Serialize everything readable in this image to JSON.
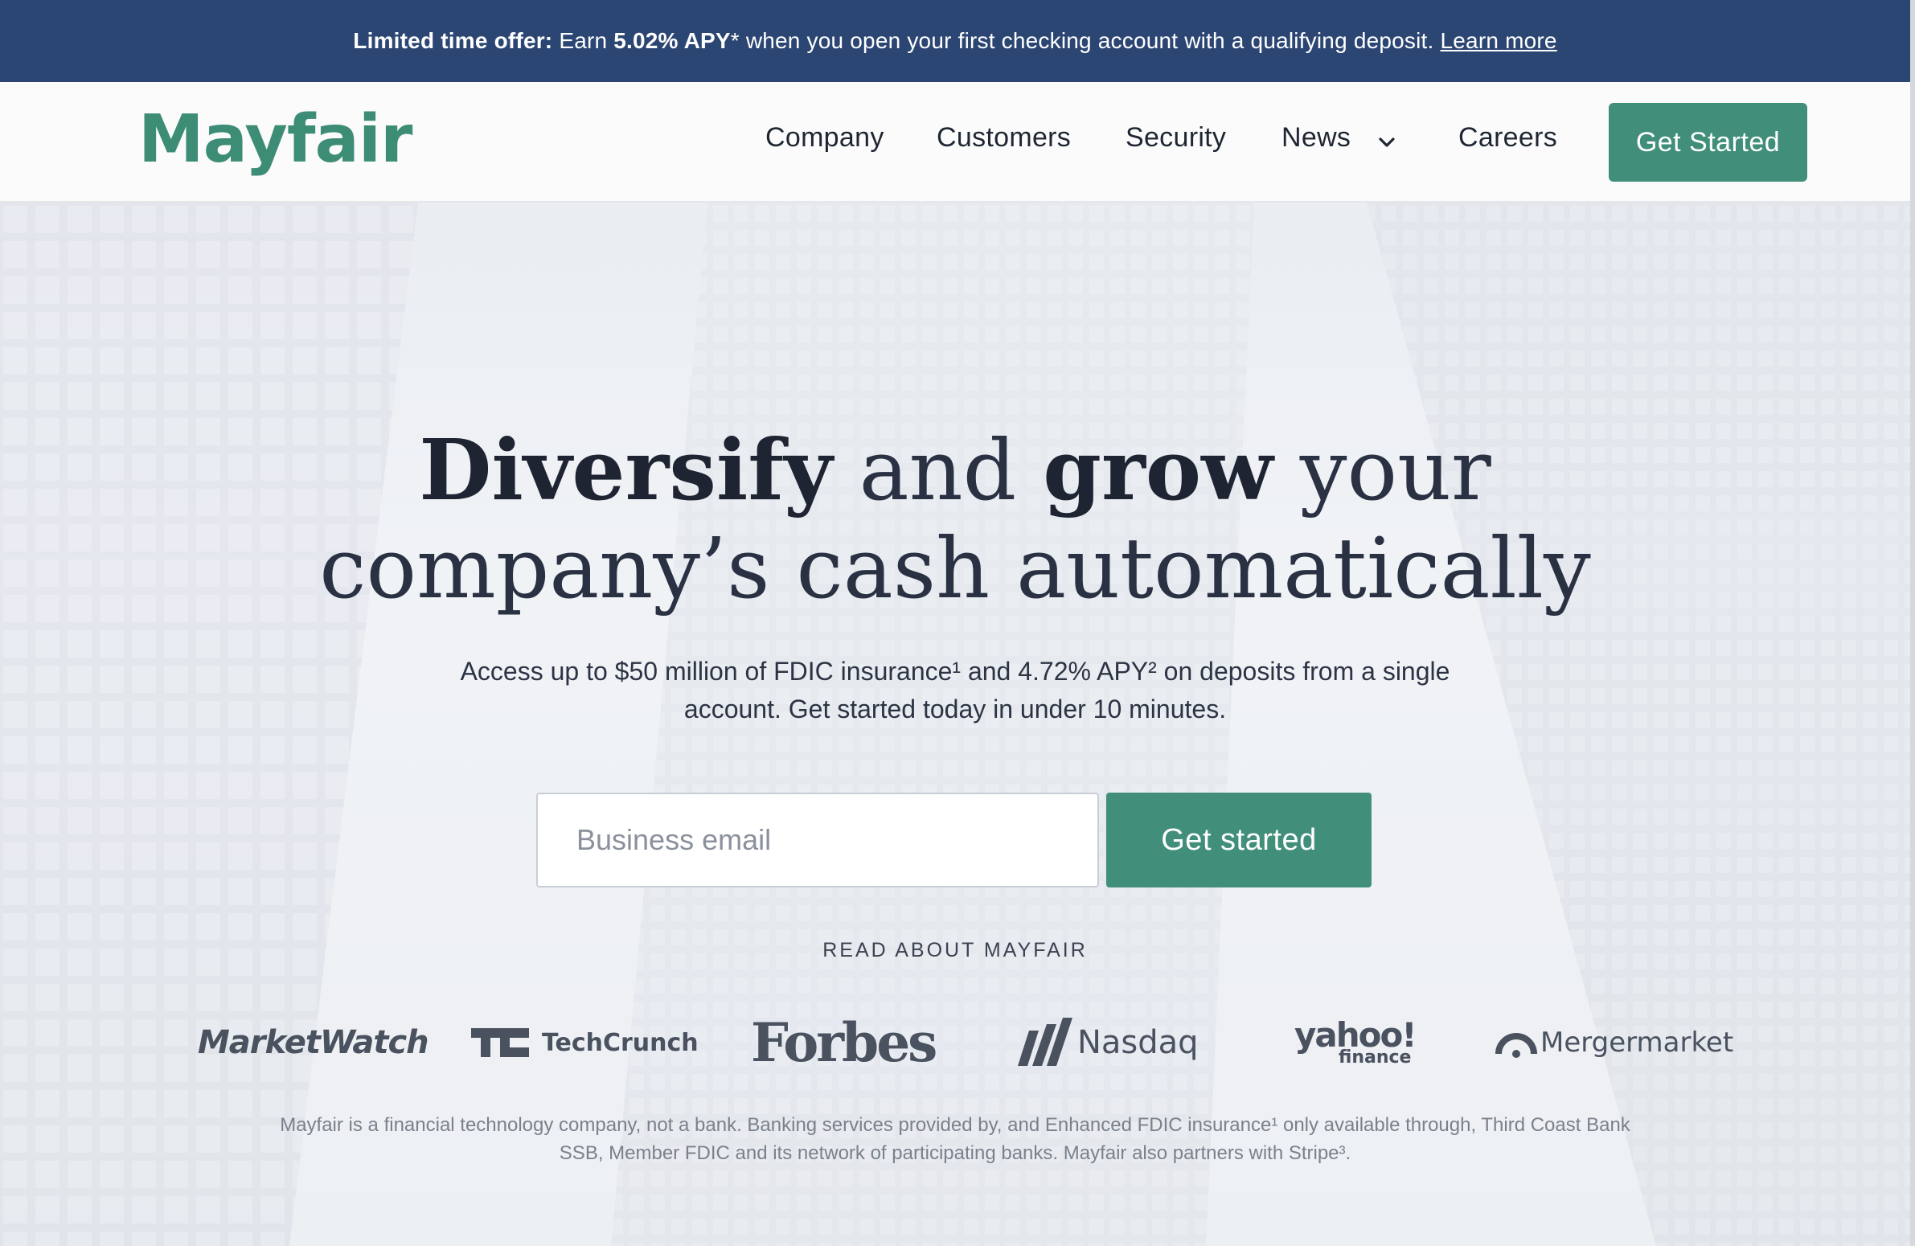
{
  "promo": {
    "lead": "Limited time offer:",
    "text_1": " Earn ",
    "rate": "5.02% APY",
    "text_2": "* when you open your first checking account with a qualifying deposit.",
    "link": "Learn more"
  },
  "nav": {
    "logo": "Mayfair",
    "items": [
      "Company",
      "Customers",
      "Security",
      "News",
      "Careers"
    ],
    "cta": "Get Started"
  },
  "hero": {
    "title_bold_1": "Diversify",
    "title_plain_1": " and ",
    "title_bold_2": "grow",
    "title_plain_2": " your",
    "title_line_2": "company’s cash automatically",
    "subtitle": "Access up to $50 million of FDIC insurance¹ and 4.72% APY² on deposits from a single account. Get started today in under 10 minutes.",
    "email_placeholder": "Business email",
    "cta": "Get started"
  },
  "press": {
    "heading": "READ ABOUT MAYFAIR",
    "logos": [
      "MarketWatch",
      "TechCrunch",
      "Forbes",
      "Nasdaq",
      "yahoo!",
      "finance",
      "Mergermarket"
    ]
  },
  "disclaimer": "Mayfair is a financial technology company, not a bank. Banking services provided by, and Enhanced FDIC insurance¹ only available through, Third Coast Bank SSB, Member FDIC and its network of participating banks. Mayfair also partners with Stripe³.",
  "colors": {
    "brand_green": "#418f7a",
    "promo_navy": "#2c4674"
  }
}
